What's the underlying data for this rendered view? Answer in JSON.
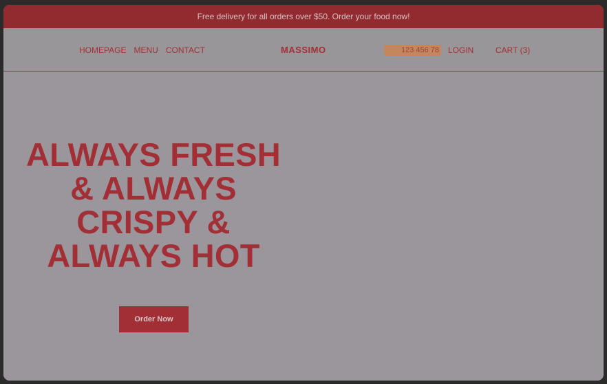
{
  "promo": {
    "text": "Free delivery for all orders over $50. Order your food now!"
  },
  "nav": {
    "links": [
      "HOMEPAGE",
      "MENU",
      "CONTACT"
    ],
    "brand": "MASSIMO",
    "phone": "123 456 78",
    "login": "LOGIN",
    "cart": "CART (3)"
  },
  "hero": {
    "title_lines": [
      "ALWAYS FRESH",
      "& ALWAYS",
      "CRISPY &",
      "ALWAYS HOT"
    ],
    "cta": "Order Now"
  },
  "colors": {
    "brand_red": "#a22f36",
    "promo_bg": "#922b2f",
    "phone_bg": "#c4865f",
    "page_bg": "#9b969b"
  }
}
